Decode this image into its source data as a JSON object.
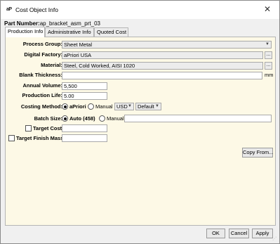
{
  "window": {
    "icon_text": "aP",
    "title": "Cost Object Info",
    "close_glyph": "✕"
  },
  "part": {
    "label": "Part Number:",
    "value": "ap_bracket_asm_prt_03"
  },
  "tabs": [
    {
      "label": "Production Info",
      "active": true
    },
    {
      "label": "Administrative Info",
      "active": false
    },
    {
      "label": "Quoted Cost",
      "active": false
    }
  ],
  "form": {
    "process_group": {
      "label": "Process Group:",
      "value": "Sheet Metal"
    },
    "digital_factory": {
      "label": "Digital Factory:",
      "value": "aPriori USA",
      "browse": "..."
    },
    "material": {
      "label": "Material:",
      "value": "Steel, Cold Worked, AISI 1020",
      "browse": "..."
    },
    "blank_thickness": {
      "label": "Blank Thickness:",
      "value": "",
      "unit": "mm"
    },
    "annual_volume": {
      "label": "Annual Volume:",
      "value": "5,500"
    },
    "production_life": {
      "label": "Production Life:",
      "value": "5.00"
    },
    "costing_method": {
      "label": "Costing Method:",
      "option_apriori": "aPriori",
      "option_manual": "Manual",
      "selected": "aPriori",
      "currency": "USD",
      "mode": "Default"
    },
    "batch_size": {
      "label": "Batch Size:",
      "option_auto": "Auto (458)",
      "option_manual": "Manual",
      "selected": "Auto",
      "manual_value": ""
    },
    "target_cost": {
      "label": "Target Cost",
      "checked": false,
      "value": ""
    },
    "target_finish_mass": {
      "label": "Target Finish Mass",
      "checked": false,
      "value": ""
    },
    "copy_from": "Copy From..."
  },
  "footer": {
    "ok": "OK",
    "cancel": "Cancel",
    "apply": "Apply"
  },
  "icons": {
    "dropdown": "chevron-down-icon",
    "close": "close-icon",
    "resize": "resize-grip-icon"
  }
}
